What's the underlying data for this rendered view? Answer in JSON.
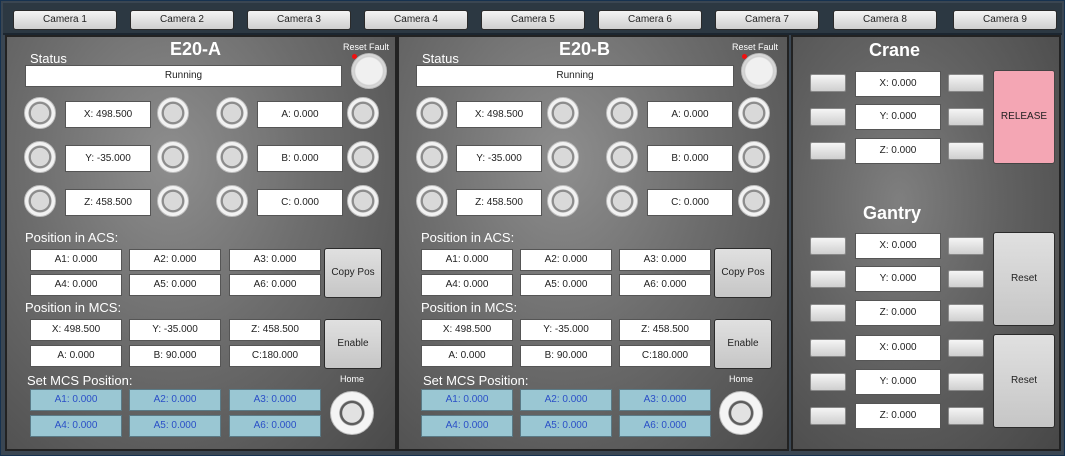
{
  "cameras": [
    "Camera 1",
    "Camera 2",
    "Camera 3",
    "Camera 4",
    "Camera 5",
    "Camera 6",
    "Camera 7",
    "Camera 8",
    "Camera 9"
  ],
  "robots": [
    {
      "name": "E20-A",
      "status_label": "Status",
      "status": "Running",
      "reset_fault": "Reset Fault",
      "left_values": [
        "X: 498.500",
        "Y: -35.000",
        "Z: 458.500"
      ],
      "right_values": [
        "A: 0.000",
        "B: 0.000",
        "C: 0.000"
      ],
      "acs_label": "Position in ACS:",
      "acs": [
        "A1: 0.000",
        "A2: 0.000",
        "A3: 0.000",
        "A4: 0.000",
        "A5: 0.000",
        "A6: 0.000"
      ],
      "copy_pos": "Copy Pos",
      "mcs_label": "Position in MCS:",
      "mcs": [
        "X: 498.500",
        "Y: -35.000",
        "Z: 458.500",
        "A: 0.000",
        "B: 90.000",
        "C:180.000"
      ],
      "enable": "Enable",
      "set_mcs_label": "Set MCS Position:",
      "set_mcs": [
        "A1: 0.000",
        "A2: 0.000",
        "A3: 0.000",
        "A4: 0.000",
        "A5: 0.000",
        "A6: 0.000"
      ],
      "home": "Home"
    },
    {
      "name": "E20-B",
      "status_label": "Status",
      "status": "Running",
      "reset_fault": "Reset Fault",
      "left_values": [
        "X: 498.500",
        "Y: -35.000",
        "Z: 458.500"
      ],
      "right_values": [
        "A: 0.000",
        "B: 0.000",
        "C: 0.000"
      ],
      "acs_label": "Position in ACS:",
      "acs": [
        "A1: 0.000",
        "A2: 0.000",
        "A3: 0.000",
        "A4: 0.000",
        "A5: 0.000",
        "A6: 0.000"
      ],
      "copy_pos": "Copy Pos",
      "mcs_label": "Position in MCS:",
      "mcs": [
        "X: 498.500",
        "Y: -35.000",
        "Z: 458.500",
        "A: 0.000",
        "B: 90.000",
        "C:180.000"
      ],
      "enable": "Enable",
      "set_mcs_label": "Set MCS Position:",
      "set_mcs": [
        "A1: 0.000",
        "A2: 0.000",
        "A3: 0.000",
        "A4: 0.000",
        "A5: 0.000",
        "A6: 0.000"
      ],
      "home": "Home"
    }
  ],
  "crane": {
    "title": "Crane",
    "values": [
      "X: 0.000",
      "Y: 0.000",
      "Z: 0.000"
    ],
    "release": "RELEASE",
    "release_color": "#f4a6b4"
  },
  "gantry": {
    "title": "Gantry",
    "group1": [
      "X: 0.000",
      "Y: 0.000",
      "Z: 0.000"
    ],
    "group2": [
      "X: 0.000",
      "Y: 0.000",
      "Z: 0.000"
    ],
    "reset1": "Reset",
    "reset2": "Reset"
  }
}
